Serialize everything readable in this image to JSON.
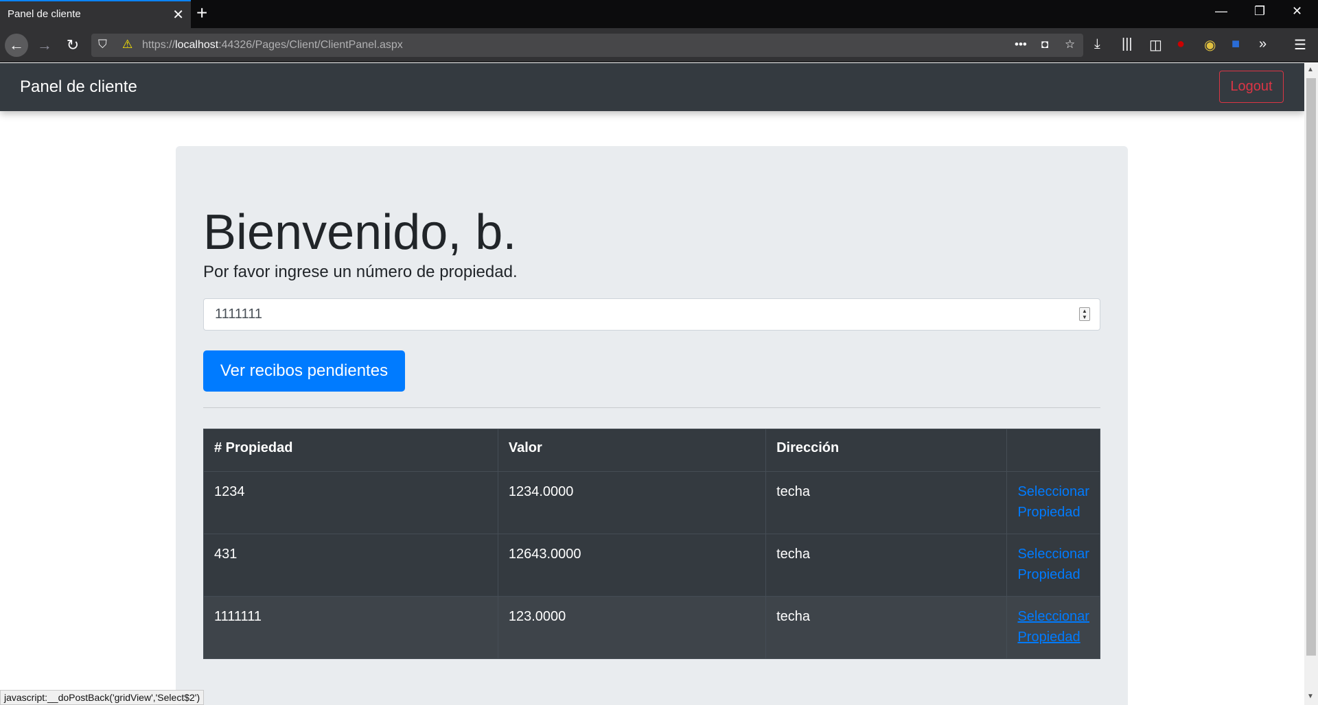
{
  "browser": {
    "tab_title": "Panel de cliente",
    "url_prefix": "https://",
    "url_host": "localhost",
    "url_rest": ":44326/Pages/Client/ClientPanel.aspx",
    "status_text": "javascript:__doPostBack('gridView','Select$2')"
  },
  "app": {
    "brand": "Panel de cliente",
    "logout_label": "Logout"
  },
  "main": {
    "welcome": "Bienvenido, b.",
    "lead": "Por favor ingrese un número de propiedad.",
    "property_input_value": "1111111",
    "submit_label": "Ver recibos pendientes"
  },
  "table": {
    "headers": [
      "# Propiedad",
      "Valor",
      "Dirección",
      ""
    ],
    "rows": [
      {
        "propiedad": "1234",
        "valor": "1234.0000",
        "direccion": "techa",
        "link_line1": "Seleccionar",
        "link_line2": "Propiedad"
      },
      {
        "propiedad": "431",
        "valor": "12643.0000",
        "direccion": "techa",
        "link_line1": "Seleccionar",
        "link_line2": "Propiedad"
      },
      {
        "propiedad": "1111111",
        "valor": "123.0000",
        "direccion": "techa",
        "link_line1": "Seleccionar",
        "link_line2": "Propiedad"
      }
    ]
  },
  "colors": {
    "navbar": "#343a40",
    "primary": "#007bff",
    "danger": "#dc3545",
    "jumbotron": "#e9ecef"
  },
  "icons": [
    "back-icon",
    "forward-icon",
    "reload-icon",
    "shield-icon",
    "lock-warning-icon",
    "more-icon",
    "pocket-icon",
    "star-icon",
    "download-icon",
    "library-icon",
    "sidebar-icon",
    "overflow-icon",
    "menu-icon",
    "close-icon",
    "plus-icon"
  ]
}
